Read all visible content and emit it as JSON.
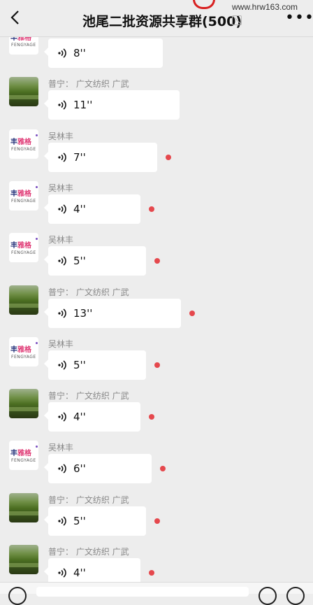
{
  "header": {
    "back_icon": "chevron-left-icon",
    "title": "池尾二批资源共享群(500)",
    "mute_icon": "bell-off-icon",
    "watermark": "www.hrw163.com",
    "more_icon": "more-dots-icon",
    "more_label": "•••"
  },
  "avatars": {
    "logo_text_left": "丰",
    "logo_text_right": "雅格",
    "logo_subtext": "FENGYAGE"
  },
  "messages": [
    {
      "sender": "",
      "avatar": "logo",
      "duration": "8''",
      "unread": false
    },
    {
      "sender": "普宁：  广文纺织 广武",
      "avatar": "photo",
      "duration": "11''",
      "unread": false
    },
    {
      "sender": "吴林丰",
      "avatar": "logo",
      "duration": "7''",
      "unread": true
    },
    {
      "sender": "吴林丰",
      "avatar": "logo",
      "duration": "4''",
      "unread": true
    },
    {
      "sender": "吴林丰",
      "avatar": "logo",
      "duration": "5''",
      "unread": true
    },
    {
      "sender": "普宁：  广文纺织 广武",
      "avatar": "photo",
      "duration": "13''",
      "unread": true
    },
    {
      "sender": "吴林丰",
      "avatar": "logo",
      "duration": "5''",
      "unread": true
    },
    {
      "sender": "普宁：  广文纺织 广武",
      "avatar": "photo",
      "duration": "4''",
      "unread": true
    },
    {
      "sender": "吴林丰",
      "avatar": "logo",
      "duration": "6''",
      "unread": true
    },
    {
      "sender": "普宁：  广文纺织 广武",
      "avatar": "photo",
      "duration": "5''",
      "unread": true
    },
    {
      "sender": "普宁：  广文纺织 广武",
      "avatar": "photo",
      "duration": "4''",
      "unread": true
    }
  ],
  "colors": {
    "unread_dot": "#e5484d",
    "bubble": "#ffffff",
    "background": "#ededed"
  }
}
